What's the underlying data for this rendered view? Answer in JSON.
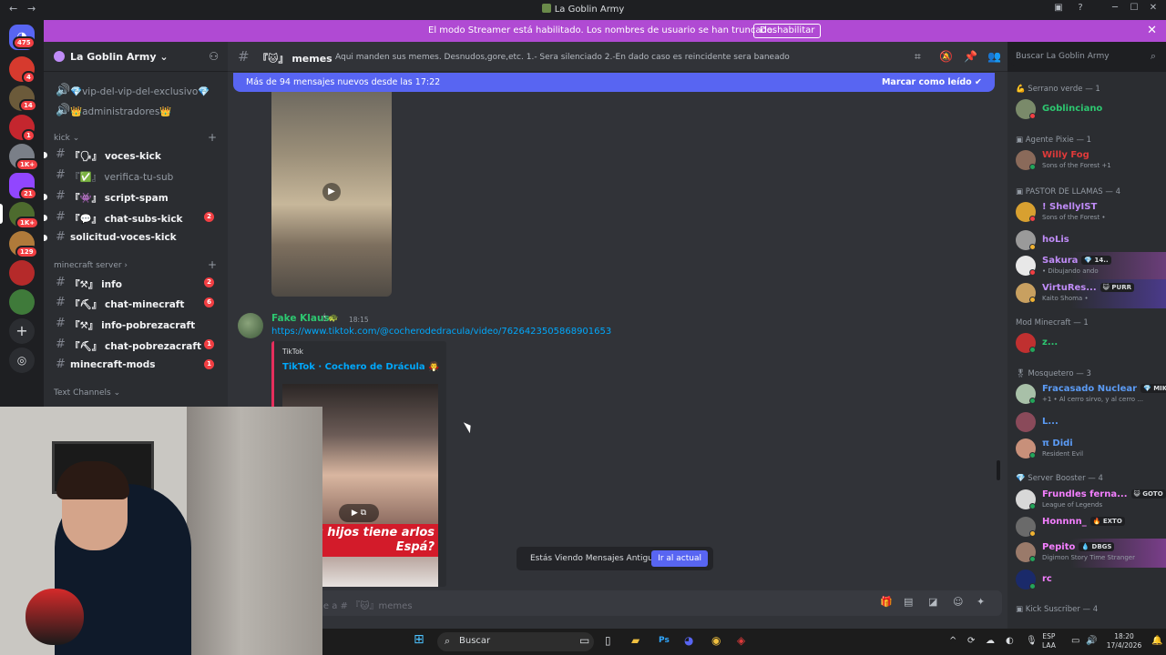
{
  "window": {
    "title": "La Goblin Army"
  },
  "banner": {
    "text": "El modo Streamer está habilitado. Los nombres de usuario se han truncado.",
    "button": "Deshabilitar"
  },
  "servers": [
    {
      "badge": "475"
    },
    {
      "badge": "4"
    },
    {
      "badge": "14"
    },
    {
      "badge": "1"
    },
    {
      "badge": "1K+"
    },
    {
      "badge": "21"
    },
    {
      "badge": "1K+"
    },
    {
      "badge": "129"
    }
  ],
  "guild": {
    "name": "La Goblin Army"
  },
  "channels": {
    "top": [
      {
        "label": "vip-del-vip-del-exclusivo",
        "emoji": "💎"
      },
      {
        "label": "administradores",
        "emoji": "👑"
      }
    ],
    "cat_kick": "kick",
    "kick": [
      {
        "label": "voces-kick",
        "prefix": "『🗣』",
        "unread": true,
        "badge": ""
      },
      {
        "label": "verifica-tu-sub",
        "prefix": "『✅』",
        "unread": false,
        "badge": ""
      },
      {
        "label": "script-spam",
        "prefix": "『👾』",
        "unread": true,
        "badge": ""
      },
      {
        "label": "chat-subs-kick",
        "prefix": "『💬』",
        "unread": true,
        "badge": "2"
      },
      {
        "label": "solicitud-voces-kick",
        "prefix": "",
        "unread": true,
        "badge": ""
      }
    ],
    "cat_mc": "minecraft server",
    "mc": [
      {
        "label": "info",
        "prefix": "『⚒』",
        "badge": "2"
      },
      {
        "label": "chat-minecraft",
        "prefix": "『⛏』",
        "badge": "6"
      },
      {
        "label": "info-pobrezacraft",
        "prefix": "『⚒』",
        "badge": ""
      },
      {
        "label": "chat-pobrezacraft",
        "prefix": "『⛏』",
        "badge": "1"
      },
      {
        "label": "minecraft-mods",
        "prefix": "",
        "badge": "1"
      }
    ],
    "cat_text": "Text Channels"
  },
  "channel_header": {
    "name": "memes",
    "prefix": "『🐱』",
    "topic": "Aqui manden sus memes. Desnudos,gore,etc. 1.- Sera silenciado 2.-En dado caso es reincidente sera baneado"
  },
  "search": {
    "placeholder": "Buscar La Goblin Army"
  },
  "chat": {
    "new_messages": "Más de 94 mensajes nuevos desde las 17:22",
    "mark_read": "Marcar como leído",
    "message": {
      "author": "Fake Klaus",
      "time": "18:15",
      "link": "https://www.tiktok.com/@cocherodedracula/video/7626423505868901653",
      "embed_provider": "TikTok",
      "embed_title": "TikTok · Cochero de Drácula",
      "thumb_caption": "ntos hijos tiene arlos Espá?"
    },
    "old_messages": "Estás Viendo Mensajes Antiguos",
    "jump": "Ir al actual",
    "composer_placeholder": "aje a # 『🐱』memes"
  },
  "members": {
    "roles": [
      {
        "name": "Serrano verde — 1"
      },
      {
        "name": "Agente Pixie — 1"
      },
      {
        "name": "PASTOR DE LLAMAS — 4"
      },
      {
        "name": "Mod Minecraft — 1"
      },
      {
        "name": "Mosquetero — 3"
      },
      {
        "name": "Server Booster — 4"
      },
      {
        "name": "Kick Suscriber — 4"
      }
    ],
    "list": [
      {
        "name": "Goblinciano",
        "color": "#2dc770",
        "activity": "",
        "tag": ""
      },
      {
        "name": "Willy Fog",
        "color": "#e03a3a",
        "activity": "Sons of the Forest +1",
        "tag": ""
      },
      {
        "name": "! ShellyIST",
        "color": "#c08cf8",
        "activity": "Sons of the Forest •",
        "tag": ""
      },
      {
        "name": "hoLis",
        "color": "#c08cf8",
        "activity": "",
        "tag": ""
      },
      {
        "name": "Sakura",
        "color": "#c08cf8",
        "activity": "• Dibujando ando",
        "tag": "💎 14.."
      },
      {
        "name": "VirtuRes...",
        "color": "#c08cf8",
        "activity": "Kaito Shoma •",
        "tag": "😺 PURR"
      },
      {
        "name": "z...",
        "color": "#2dc770",
        "activity": "",
        "tag": ""
      },
      {
        "name": "Fracasado Nuclear",
        "color": "#5b9bf5",
        "activity": "+1 • Al cerro sirvo, y al cerro ...",
        "tag": "💎 MIKU"
      },
      {
        "name": "L...",
        "color": "#5b9bf5",
        "activity": "",
        "tag": ""
      },
      {
        "name": "π Didi",
        "color": "#5b9bf5",
        "activity": "Resident Evil",
        "tag": ""
      },
      {
        "name": "Frundles ferna...",
        "color": "#f47fff",
        "activity": "League of Legends",
        "tag": "😺 GOTO"
      },
      {
        "name": "Honnnn_",
        "color": "#f47fff",
        "activity": "",
        "tag": "🔥 EXTO"
      },
      {
        "name": "Pepito",
        "color": "#f47fff",
        "activity": "Digimon Story Time Stranger",
        "tag": "💧 DBGS"
      },
      {
        "name": "rc",
        "color": "#f47fff",
        "activity": "",
        "tag": ""
      }
    ]
  },
  "taskbar": {
    "search": "Buscar",
    "lang": "ESP",
    "lang2": "LAA",
    "time": "18:20",
    "date": "17/4/2026"
  }
}
